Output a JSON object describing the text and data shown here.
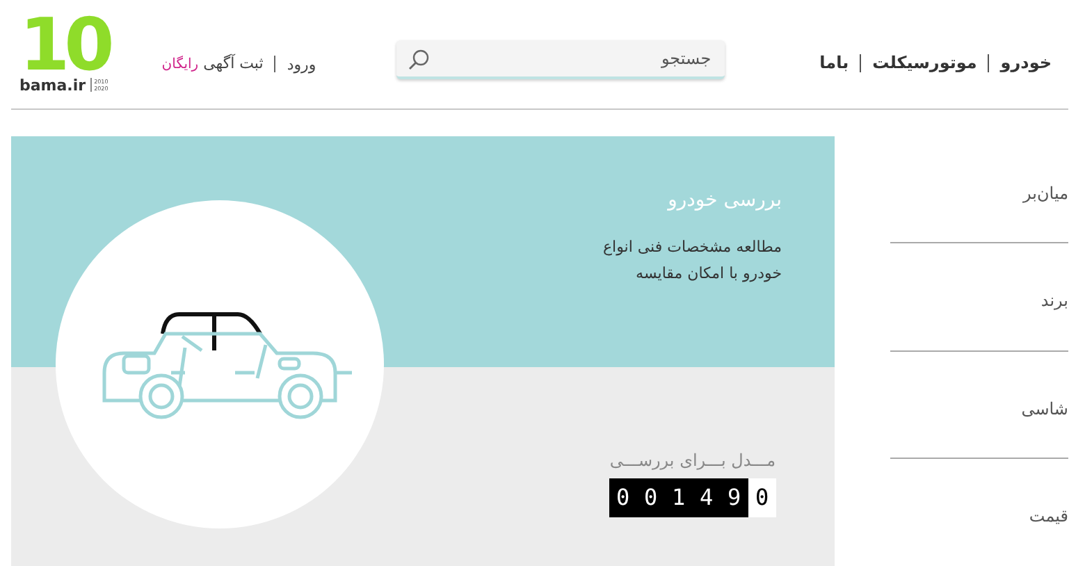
{
  "logo": {
    "number": "10",
    "name": "bama.ir",
    "years": [
      "2010",
      "2020"
    ]
  },
  "account_links": [
    {
      "kind": "link",
      "label": "ورود"
    },
    {
      "kind": "post",
      "label": "ثبت آگهی",
      "badge": "رایگان"
    }
  ],
  "search": {
    "placeholder": "جستجو"
  },
  "nav": [
    {
      "label": "خودرو"
    },
    {
      "label": "موتورسیکلت"
    },
    {
      "label": "باما"
    }
  ],
  "review_panel": {
    "title": "بررسی خودرو",
    "description": "مطالعه مشخصات فنی انواع خودرو با امکان مقایسه",
    "counter_label": "مـــدل بـــرای بررســـی",
    "counter": "001490"
  },
  "filters": [
    {
      "label": "میان‌بر"
    },
    {
      "label": "برند"
    },
    {
      "label": "شاسی"
    },
    {
      "label": "قیمت"
    }
  ]
}
